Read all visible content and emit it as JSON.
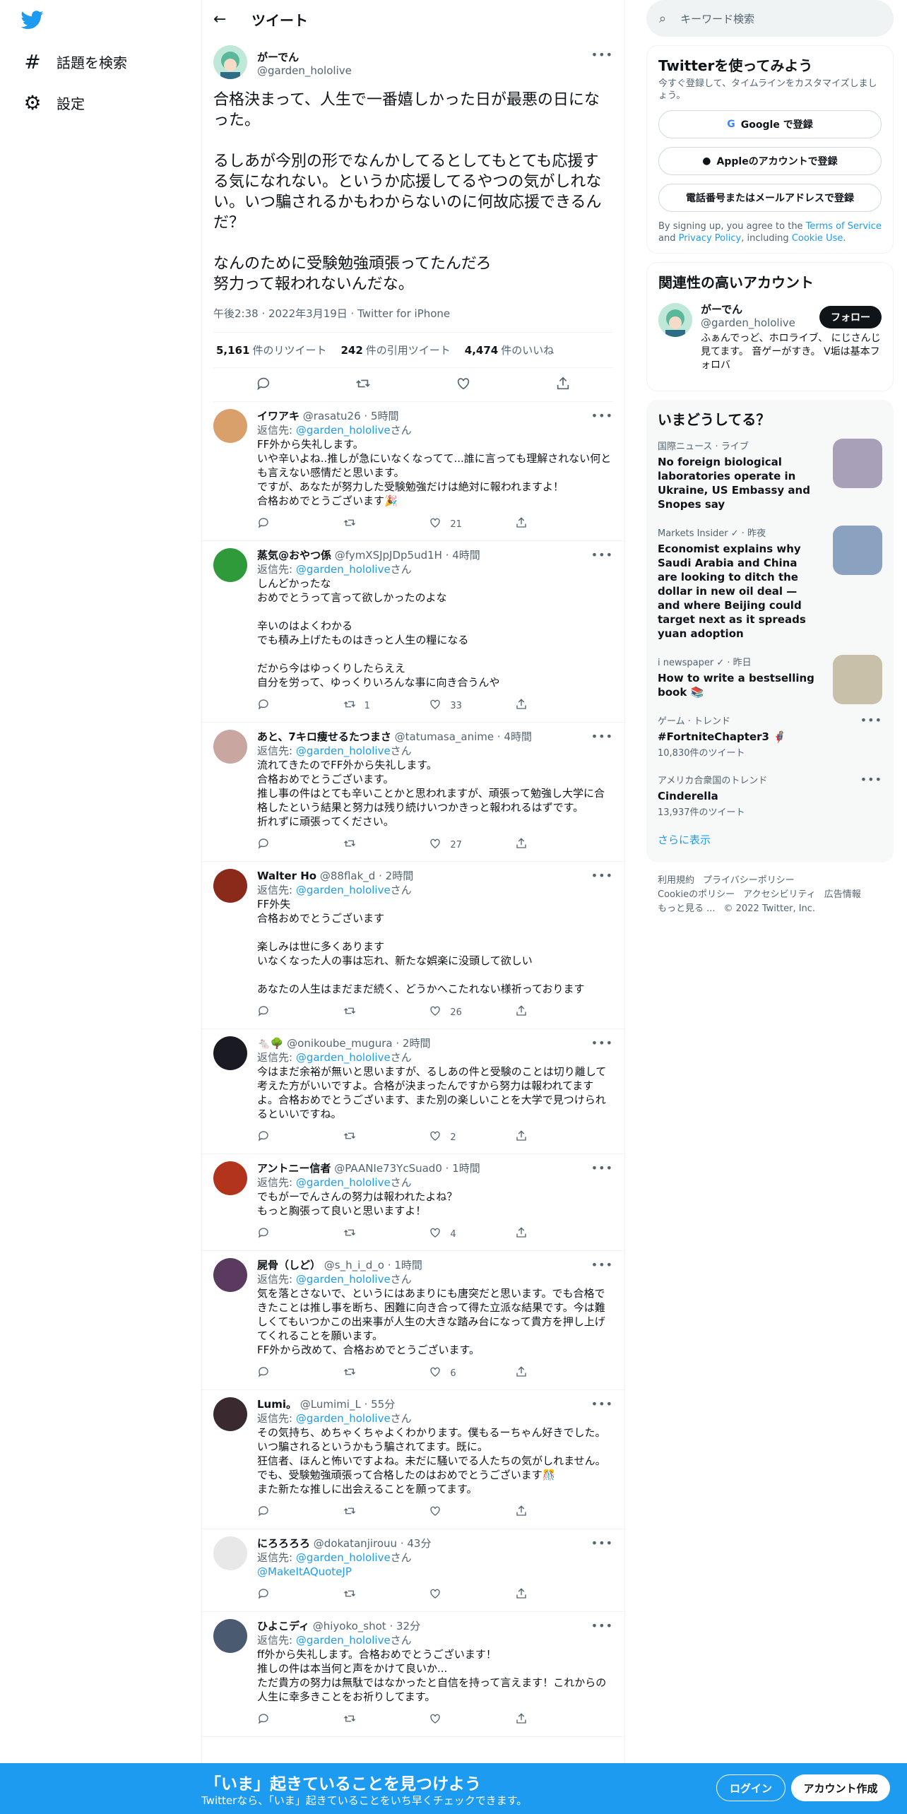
{
  "nav": {
    "items": [
      {
        "icon": "hashtag-icon",
        "label": "話題を検索"
      },
      {
        "icon": "gear-icon",
        "label": "設定"
      }
    ]
  },
  "header": {
    "title": "ツイート"
  },
  "focal": {
    "name": "がーでん",
    "handle": "@garden_hololive",
    "text": "合格決まって、人生で一番嬉しかった日が最悪の日になった。\n\nるしあが今別の形でなんかしてるとしてもとても応援する気になれない。というか応援してるやつの気がしれない。いつ騙されるかもわからないのに何故応援できるんだ？\n\nなんのために受験勉強頑張ってたんだろ\n努力って報われないんだな。",
    "meta": "午後2:38 · 2022年3月19日 · Twitter for iPhone",
    "stats": [
      {
        "num": "5,161",
        "label": "件のリツイート"
      },
      {
        "num": "242",
        "label": "件の引用ツイート"
      },
      {
        "num": "4,474",
        "label": "件のいいね"
      }
    ]
  },
  "replies": [
    {
      "name": "イワアキ",
      "handle": "@rasatu26",
      "time": "· 5時間",
      "to_prefix": "返信先: ",
      "to": "@garden_hololive",
      "to_suffix": "さん",
      "text": "FF外から失礼します。\nいや辛いよね..推しが急にいなくなってて...誰に言っても理解されない何とも言えない感情だと思います。\nですが、あなたが努力した受験勉強だけは絶対に報われますよ！\n合格おめでとうございます🎉",
      "retweets": "",
      "likes": "21",
      "avatar_color": "#d9a06b"
    },
    {
      "name": "蒸気@おやつ係",
      "handle": "@fymXSJpJDp5ud1H",
      "time": "· 4時間",
      "to_prefix": "返信先: ",
      "to": "@garden_hololive",
      "to_suffix": "さん",
      "text": "しんどかったな\nおめでとうって言って欲しかったのよな\n\n辛いのはよくわかる\nでも積み上げたものはきっと人生の糧になる\n\nだから今はゆっくりしたらええ\n自分を労って、ゆっくりいろんな事に向き合うんや",
      "retweets": "1",
      "likes": "33",
      "avatar_color": "#2e9a3a"
    },
    {
      "name": "あと、7キロ痩せるたつまさ",
      "handle": "@tatumasa_anime",
      "time": "· 4時間",
      "to_prefix": "返信先: ",
      "to": "@garden_hololive",
      "to_suffix": "さん",
      "text": "流れてきたのでFF外から失礼します。\n合格おめでとうございます。\n推し事の件はとても辛いことかと思われますが、頑張って勉強し大学に合格したという結果と努力は残り続けいつかきっと報われるはずです。\n折れずに頑張ってください。",
      "retweets": "",
      "likes": "27",
      "avatar_color": "#c9a7a0"
    },
    {
      "name": "Walter Ho",
      "handle": "@88flak_d",
      "time": "· 2時間",
      "to_prefix": "返信先: ",
      "to": "@garden_hololive",
      "to_suffix": "さん",
      "text": "FF外失\n合格おめでとうございます\n\n楽しみは世に多くあります\nいなくなった人の事は忘れ、新たな娯楽に没頭して欲しい\n\nあなたの人生はまだまだ続く、どうかへこたれない様祈っております",
      "retweets": "",
      "likes": "26",
      "avatar_color": "#8a2a1a"
    },
    {
      "name": "🐁🌳",
      "handle": "@onikoube_mugura",
      "time": "· 2時間",
      "to_prefix": "返信先: ",
      "to": "@garden_hololive",
      "to_suffix": "さん",
      "text": "今はまだ余裕が無いと思いますが、るしあの件と受験のことは切り離して考えた方がいいですよ。合格が決まったんですから努力は報われてますよ。合格おめでとうございます、また別の楽しいことを大学で見つけられるといいですね。",
      "retweets": "",
      "likes": "2",
      "avatar_color": "#1a1a22"
    },
    {
      "name": "アントニー信者",
      "handle": "@PAANIe73YcSuad0",
      "time": "· 1時間",
      "to_prefix": "返信先: ",
      "to": "@garden_hololive",
      "to_suffix": "さん",
      "text": "でもがーでんさんの努力は報われたよね？\nもっと胸張って良いと思いますよ！",
      "retweets": "",
      "likes": "4",
      "avatar_color": "#b3341c"
    },
    {
      "name": "屍骨（しど）",
      "handle": "@s_h_i_d_o",
      "time": "· 1時間",
      "to_prefix": "返信先: ",
      "to": "@garden_hololive",
      "to_suffix": "さん",
      "text": "気を落とさないで、というにはあまりにも唐突だと思います。でも合格できたことは推し事を断ち、困難に向き合って得た立派な結果です。今は難しくてもいつかこの出来事が人生の大きな踏み台になって貴方を押し上げてくれることを願います。\nFF外から改めて、合格おめでとうございます。",
      "retweets": "",
      "likes": "6",
      "avatar_color": "#5a3a5e"
    },
    {
      "name": "Lumi。",
      "handle": "@Lumimi_L",
      "time": "· 55分",
      "to_prefix": "返信先: ",
      "to": "@garden_hololive",
      "to_suffix": "さん",
      "text": "その気持ち、めちゃくちゃよくわかります。僕もるーちゃん好きでした。いつ騙されるというかもう騙されてます。既に。\n狂信者、ほんと怖いですよね。未だに騒いでる人たちの気がしれません。\nでも、受験勉強頑張って合格したのはおめでとうございます🎊\nまた新たな推しに出会えることを願ってます。",
      "retweets": "",
      "likes": "",
      "avatar_color": "#3a2a30"
    },
    {
      "name": "にろろろろ",
      "handle": "@dokatanjirouu",
      "time": "· 43分",
      "to_prefix": "返信先: ",
      "to": "@garden_hololive",
      "to_suffix": "さん",
      "text": "",
      "link": "@MakeItAQuoteJP",
      "retweets": "",
      "likes": "",
      "avatar_color": "#e8e8e8"
    },
    {
      "name": "ひよこディ",
      "handle": "@hiyoko_shot",
      "time": "· 32分",
      "to_prefix": "返信先: ",
      "to": "@garden_hololive",
      "to_suffix": "さん",
      "text": "ff外から失礼します。合格おめでとうございます！\n推しの件は本当何と声をかけて良いか...\nただ貴方の努力は無駄ではなかったと自信を持って言えます！これからの人生に幸多きことをお祈りしてます。",
      "retweets": "",
      "likes": "",
      "avatar_color": "#4a5a70"
    }
  ],
  "search": {
    "placeholder": "キーワード検索"
  },
  "signup_card": {
    "title": "Twitterを使ってみよう",
    "sub": "今すぐ登録して、タイムラインをカスタマイズしましょう。",
    "google": "Google で登録",
    "apple": "Appleのアカウントで登録",
    "phone": "電話番号またはメールアドレスで登録",
    "legal_1": "By signing up, you agree to the ",
    "tos": "Terms of Service",
    "legal_2": " and ",
    "privacy": "Privacy Policy",
    "legal_3": ", including ",
    "cookie": "Cookie Use",
    "legal_4": "."
  },
  "related": {
    "title": "関連性の高いアカウント",
    "name": "がーでん",
    "handle": "@garden_hololive",
    "bio": "ふぁんでっど、ホロライブ、 にじさんじ見てます。 音ゲーがすき。 V垢は基本フォロバ",
    "follow": "フォロー"
  },
  "trends": {
    "title": "いまどうしてる？",
    "items": [
      {
        "meta": "国際ニュース · ライブ",
        "title": "No foreign biological laboratories operate in Ukraine, US Embassy and Snopes say",
        "count": "",
        "img": "#a8a0b8"
      },
      {
        "meta": "Markets Insider ✓ · 昨夜",
        "title": "Economist explains why Saudi Arabia and China are looking to ditch the dollar in new oil deal — and where Beijing could target next as it spreads yuan adoption",
        "count": "",
        "img": "#8aa2c0"
      },
      {
        "meta": "i newspaper ✓ · 昨日",
        "title": "How to write a bestselling book 📚",
        "count": "",
        "img": "#c8c0a8"
      },
      {
        "meta": "ゲーム · トレンド",
        "title": "#FortniteChapter3 🦸",
        "count": "10,830件のツイート",
        "img": ""
      },
      {
        "meta": "アメリカ合衆国のトレンド",
        "title": "Cinderella",
        "count": "13,937件のツイート",
        "img": ""
      }
    ],
    "more": "さらに表示"
  },
  "footer": {
    "line1": [
      "利用規約",
      "プライバシーポリシー"
    ],
    "line2": [
      "Cookieのポリシー",
      "アクセシビリティ",
      "広告情報"
    ],
    "line3": [
      "もっと見る ...",
      "© 2022 Twitter, Inc."
    ]
  },
  "banner": {
    "title": "「いま」起きていることを見つけよう",
    "sub": "Twitterなら、「いま」起きていることをいち早くチェックできます。",
    "login": "ログイン",
    "signup": "アカウント作成"
  }
}
